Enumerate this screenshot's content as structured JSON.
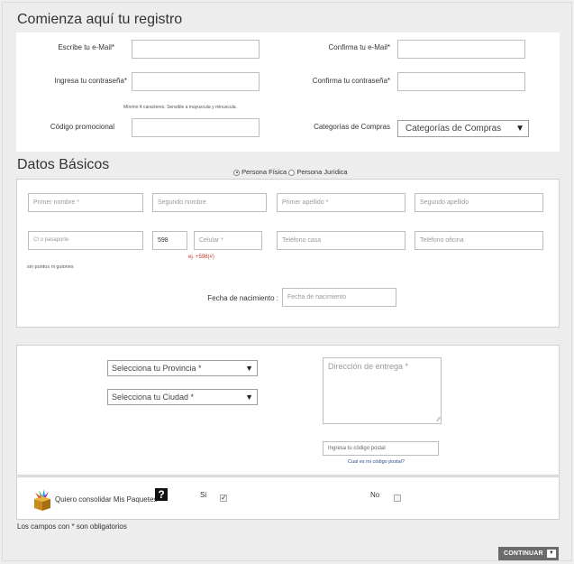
{
  "registro": {
    "title": "Comienza aquí tu registro",
    "email_label": "Escribe tu e-Mail*",
    "confirm_email_label": "Confirma tu e-Mail*",
    "password_label": "Ingresa tu contraseña*",
    "confirm_password_label": "Confirma tu contraseña*",
    "password_hint": "Mínimo 4 caracteres. Sensible a mayuscula y minuscula.",
    "promo_label": "Código promocional",
    "categories_label": "Categorías de Compras",
    "categories_selected": "Categorías de Compras"
  },
  "datos": {
    "title": "Datos Básicos",
    "radio_fisica": "Persona Física",
    "radio_juridica": "Persona Jurídica",
    "first_name_ph": "Primer nombre *",
    "second_name_ph": "Segundo nombre",
    "first_surname_ph": "Primer apellido *",
    "second_surname_ph": "Segundo apellido",
    "ci_ph": "CI o pasaporte",
    "ci_hint": "sin puntos ni guiones",
    "country_code": "598",
    "cellular_ph": "Celular *",
    "cellular_example": "ej. +598(#)",
    "home_phone_ph": "Teléfono casa",
    "office_phone_ph": "Teléfono oficina",
    "birth_label": "Fecha de nacimiento :",
    "birth_ph": "Fecha de nacimiento"
  },
  "direccion": {
    "province_selected": "Selecciona tu Provincia *",
    "city_selected": "Selecciona tu Ciudad *",
    "address_ph": "Dirección de entrega *",
    "postal_ph": "Ingresa tu código postal",
    "postal_link": "Cual es mi código postal?"
  },
  "paquetes": {
    "label": "Quiero consolidar Mis Paquetes",
    "help": "?",
    "si_label": "Si",
    "no_label": "No",
    "si_checked": true,
    "no_checked": false
  },
  "footer": {
    "required_note": "Los campos con * son obligatorios",
    "continue_label": "CONTINUAR",
    "continue_arrow": "▼"
  }
}
